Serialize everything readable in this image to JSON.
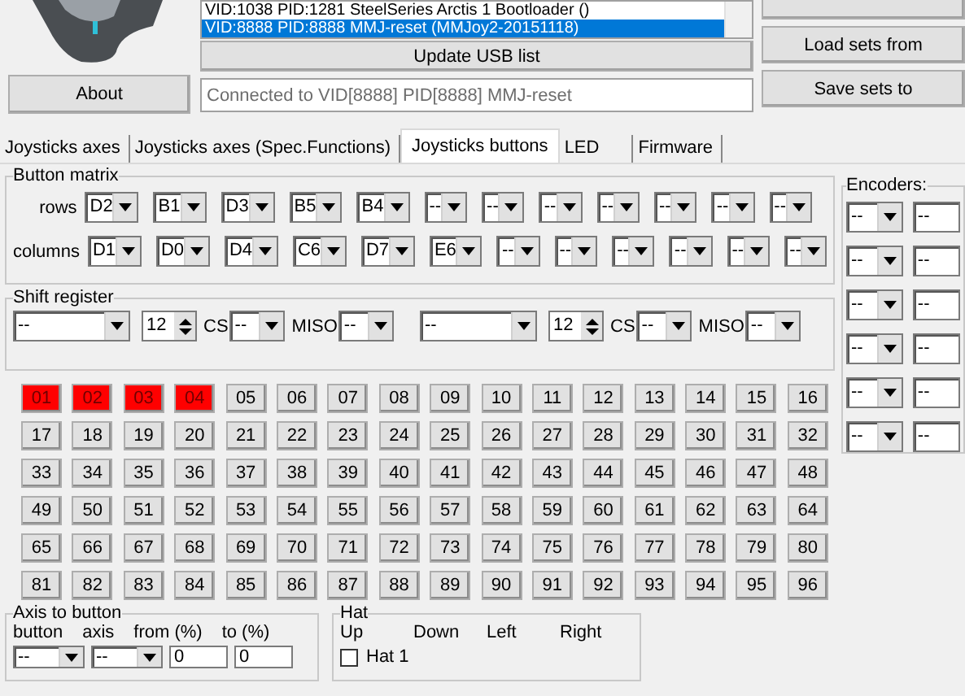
{
  "about_button": "About",
  "usb_list": {
    "items": [
      {
        "text": "VID:1038 PID:1281 SteelSeries Arctis 1 Bootloader ()",
        "selected": false
      },
      {
        "text": "VID:8888 PID:8888 MMJ-reset (MMJoy2-20151118)",
        "selected": true
      }
    ]
  },
  "update_button": "Update USB list",
  "status": {
    "value": "Connected to VID[8888] PID[8888] MMJ-reset"
  },
  "right_buttons": [
    "Load sets from",
    "Save sets to"
  ],
  "tabs": [
    {
      "label": "Joysticks axes",
      "selected": false
    },
    {
      "label": "Joysticks axes (Spec.Functions)",
      "selected": false
    },
    {
      "label": "Joysticks buttons",
      "selected": true
    },
    {
      "label": "LED",
      "selected": false
    },
    {
      "label": "Firmware",
      "selected": false
    }
  ],
  "button_matrix": {
    "title": "Button matrix",
    "rows_label": "rows",
    "columns_label": "columns",
    "rows": [
      "D2",
      "B1",
      "D3",
      "B5",
      "B4",
      "--",
      "--",
      "--",
      "--",
      "--",
      "--",
      "--"
    ],
    "columns": [
      "D1",
      "D0",
      "D4",
      "C6",
      "D7",
      "E6",
      "--",
      "--",
      "--",
      "--",
      "--",
      "--"
    ]
  },
  "shift_register": {
    "title": "Shift register",
    "units": [
      {
        "pin": "--",
        "count": "12",
        "cs_label": "CS",
        "cs": "--",
        "miso_label": "MISO",
        "miso": "--"
      },
      {
        "pin": "--",
        "count": "12",
        "cs_label": "CS",
        "cs": "--",
        "miso_label": "MISO",
        "miso": "--"
      }
    ]
  },
  "encoders": {
    "title": "Encoders:",
    "rows": [
      [
        "--",
        "--"
      ],
      [
        "--",
        "--"
      ],
      [
        "--",
        "--"
      ],
      [
        "--",
        "--"
      ],
      [
        "--",
        "--"
      ],
      [
        "--",
        "--"
      ]
    ]
  },
  "buttons": [
    {
      "label": "01",
      "on": true
    },
    {
      "label": "02",
      "on": true
    },
    {
      "label": "03",
      "on": true
    },
    {
      "label": "04",
      "on": true
    },
    {
      "label": "05",
      "on": false
    },
    {
      "label": "06",
      "on": false
    },
    {
      "label": "07",
      "on": false
    },
    {
      "label": "08",
      "on": false
    },
    {
      "label": "09",
      "on": false
    },
    {
      "label": "10",
      "on": false
    },
    {
      "label": "11",
      "on": false
    },
    {
      "label": "12",
      "on": false
    },
    {
      "label": "13",
      "on": false
    },
    {
      "label": "14",
      "on": false
    },
    {
      "label": "15",
      "on": false
    },
    {
      "label": "16",
      "on": false
    },
    {
      "label": "17",
      "on": false
    },
    {
      "label": "18",
      "on": false
    },
    {
      "label": "19",
      "on": false
    },
    {
      "label": "20",
      "on": false
    },
    {
      "label": "21",
      "on": false
    },
    {
      "label": "22",
      "on": false
    },
    {
      "label": "23",
      "on": false
    },
    {
      "label": "24",
      "on": false
    },
    {
      "label": "25",
      "on": false
    },
    {
      "label": "26",
      "on": false
    },
    {
      "label": "27",
      "on": false
    },
    {
      "label": "28",
      "on": false
    },
    {
      "label": "29",
      "on": false
    },
    {
      "label": "30",
      "on": false
    },
    {
      "label": "31",
      "on": false
    },
    {
      "label": "32",
      "on": false
    },
    {
      "label": "33",
      "on": false
    },
    {
      "label": "34",
      "on": false
    },
    {
      "label": "35",
      "on": false
    },
    {
      "label": "36",
      "on": false
    },
    {
      "label": "37",
      "on": false
    },
    {
      "label": "38",
      "on": false
    },
    {
      "label": "39",
      "on": false
    },
    {
      "label": "40",
      "on": false
    },
    {
      "label": "41",
      "on": false
    },
    {
      "label": "42",
      "on": false
    },
    {
      "label": "43",
      "on": false
    },
    {
      "label": "44",
      "on": false
    },
    {
      "label": "45",
      "on": false
    },
    {
      "label": "46",
      "on": false
    },
    {
      "label": "47",
      "on": false
    },
    {
      "label": "48",
      "on": false
    },
    {
      "label": "49",
      "on": false
    },
    {
      "label": "50",
      "on": false
    },
    {
      "label": "51",
      "on": false
    },
    {
      "label": "52",
      "on": false
    },
    {
      "label": "53",
      "on": false
    },
    {
      "label": "54",
      "on": false
    },
    {
      "label": "55",
      "on": false
    },
    {
      "label": "56",
      "on": false
    },
    {
      "label": "57",
      "on": false
    },
    {
      "label": "58",
      "on": false
    },
    {
      "label": "59",
      "on": false
    },
    {
      "label": "60",
      "on": false
    },
    {
      "label": "61",
      "on": false
    },
    {
      "label": "62",
      "on": false
    },
    {
      "label": "63",
      "on": false
    },
    {
      "label": "64",
      "on": false
    },
    {
      "label": "65",
      "on": false
    },
    {
      "label": "66",
      "on": false
    },
    {
      "label": "67",
      "on": false
    },
    {
      "label": "68",
      "on": false
    },
    {
      "label": "69",
      "on": false
    },
    {
      "label": "70",
      "on": false
    },
    {
      "label": "71",
      "on": false
    },
    {
      "label": "72",
      "on": false
    },
    {
      "label": "73",
      "on": false
    },
    {
      "label": "74",
      "on": false
    },
    {
      "label": "75",
      "on": false
    },
    {
      "label": "76",
      "on": false
    },
    {
      "label": "77",
      "on": false
    },
    {
      "label": "78",
      "on": false
    },
    {
      "label": "79",
      "on": false
    },
    {
      "label": "80",
      "on": false
    },
    {
      "label": "81",
      "on": false
    },
    {
      "label": "82",
      "on": false
    },
    {
      "label": "83",
      "on": false
    },
    {
      "label": "84",
      "on": false
    },
    {
      "label": "85",
      "on": false
    },
    {
      "label": "86",
      "on": false
    },
    {
      "label": "87",
      "on": false
    },
    {
      "label": "88",
      "on": false
    },
    {
      "label": "89",
      "on": false
    },
    {
      "label": "90",
      "on": false
    },
    {
      "label": "91",
      "on": false
    },
    {
      "label": "92",
      "on": false
    },
    {
      "label": "93",
      "on": false
    },
    {
      "label": "94",
      "on": false
    },
    {
      "label": "95",
      "on": false
    },
    {
      "label": "96",
      "on": false
    }
  ],
  "axis_to_button": {
    "title": "Axis to button",
    "headers": [
      "button",
      "axis",
      "from (%)",
      "to (%)"
    ],
    "button": "--",
    "axis": "--",
    "from": "0",
    "to": "0"
  },
  "hat": {
    "title": "Hat",
    "headers": [
      "Up",
      "Down",
      "Left",
      "Right"
    ],
    "items": [
      {
        "label": "Hat 1",
        "checked": false
      }
    ]
  }
}
